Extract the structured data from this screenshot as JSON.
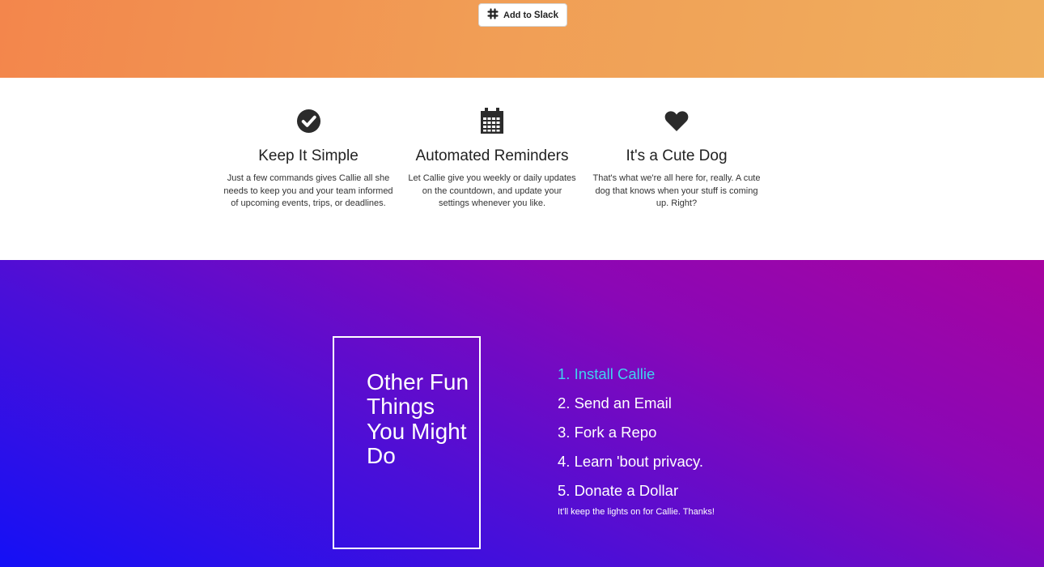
{
  "header": {
    "slack_button": {
      "prefix": "Add to",
      "brand": "Slack",
      "icon": "slack-icon"
    },
    "colors": {
      "gradient_start": "#f3864c",
      "gradient_end": "#efaf5e"
    }
  },
  "features": [
    {
      "icon": "check-circle-icon",
      "title": "Keep It Simple",
      "text": "Just a few commands gives Callie all she needs to keep you and your team informed of upcoming events, trips, or deadlines."
    },
    {
      "icon": "calendar-icon",
      "title": "Automated Reminders",
      "text": "Let Callie give you weekly or daily updates on the countdown, and update your settings whenever you like."
    },
    {
      "icon": "heart-icon",
      "title": "It's a Cute Dog",
      "text": "That's what we're all here for, really. A cute dog that knows when your stuff is coming up. Right?"
    }
  ],
  "fun": {
    "box_title": "Other Fun Things You Might Do",
    "items": [
      {
        "label": "1. Install Callie",
        "active": true
      },
      {
        "label": "2. Send an Email",
        "active": false
      },
      {
        "label": "3. Fork a Repo",
        "active": false
      },
      {
        "label": "4. Learn 'bout privacy.",
        "active": false
      },
      {
        "label": "5. Donate a Dollar",
        "active": false
      }
    ],
    "note": "It'll keep the lights on for Callie. Thanks!",
    "colors": {
      "gradient_start": "#1410f6",
      "gradient_end": "#a8049f",
      "active_link": "#3fd3ee"
    }
  }
}
